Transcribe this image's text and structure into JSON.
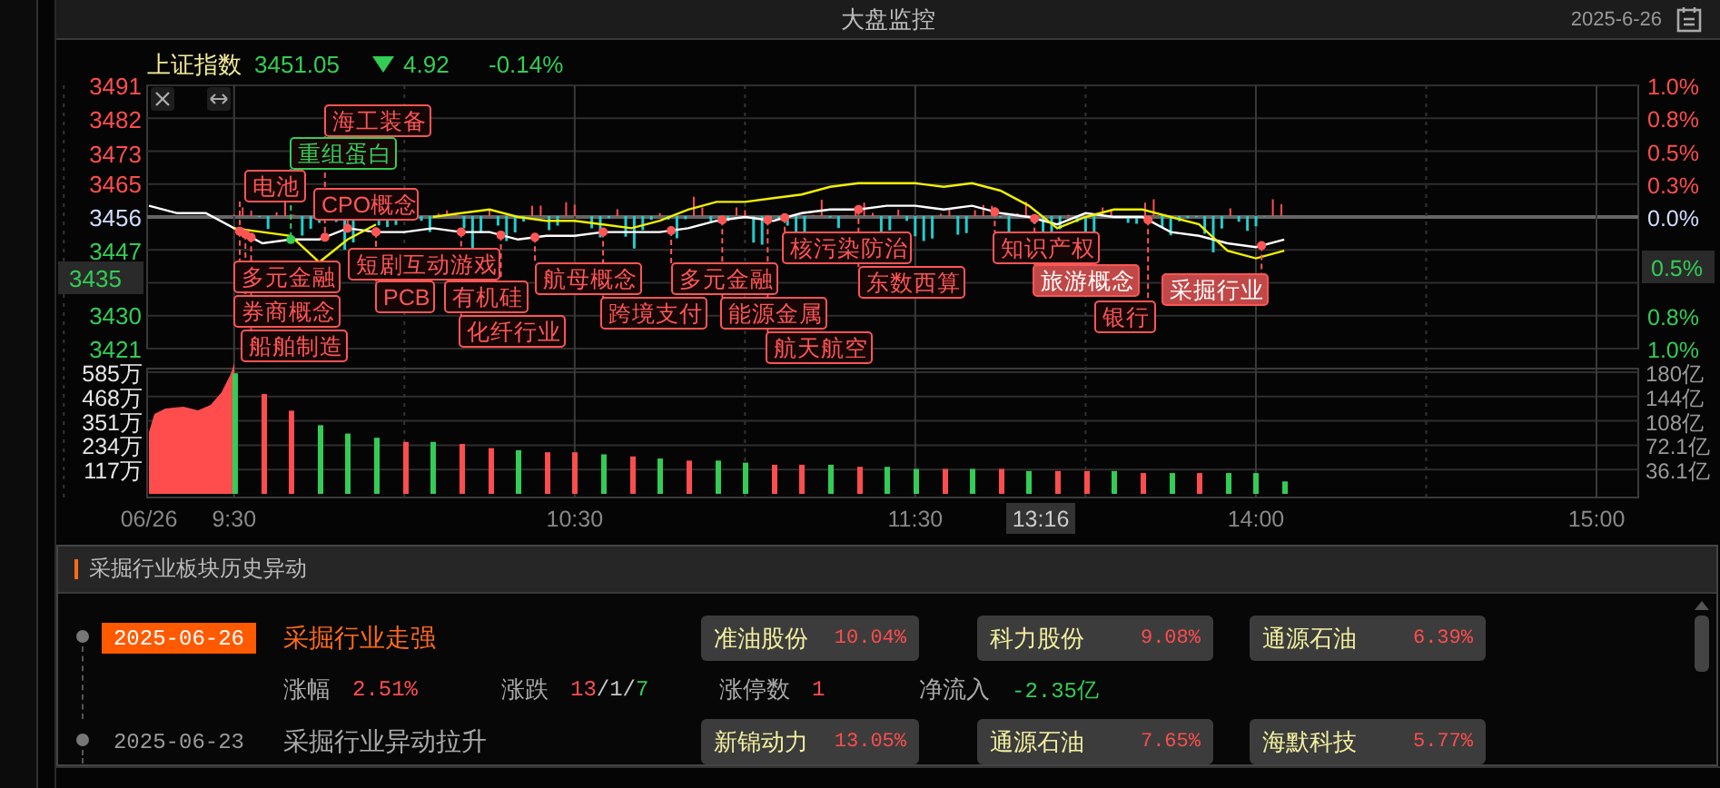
{
  "window": {
    "title": "大盘监控",
    "date": "2025-6-26"
  },
  "quote": {
    "name": "上证指数",
    "price": "3451.05",
    "change": "4.92",
    "percent": "-0.14%",
    "falling": true
  },
  "price_chart": {
    "cursor": {
      "price": "3435",
      "percent": "0.5%",
      "time": "13:16"
    },
    "right_ticks": [
      {
        "label": "1.0%",
        "kind": "up"
      },
      {
        "label": "0.8%",
        "kind": "up"
      },
      {
        "label": "0.5%",
        "kind": "up"
      },
      {
        "label": "0.3%",
        "kind": "up"
      },
      {
        "label": "0.0%",
        "kind": "flat"
      },
      {
        "label": "0.8%",
        "kind": "down"
      },
      {
        "label": "1.0%",
        "kind": "down"
      }
    ],
    "events": [
      {
        "text": "海工装备",
        "color": "#ff5555",
        "selected": false
      },
      {
        "text": "重组蛋白",
        "color": "#33cc55",
        "selected": false
      },
      {
        "text": "电池",
        "color": "#ff5555",
        "selected": false
      },
      {
        "text": "CPO概念",
        "color": "#ff5555",
        "selected": false
      },
      {
        "text": "核污染防治",
        "color": "#ff5555",
        "selected": false
      },
      {
        "text": "知识产权",
        "color": "#ff5555",
        "selected": false
      },
      {
        "text": "短剧互动游戏",
        "color": "#ff5555",
        "selected": false
      },
      {
        "text": "多元金融",
        "color": "#ff5555",
        "selected": false
      },
      {
        "text": "航母概念",
        "color": "#ff5555",
        "selected": false
      },
      {
        "text": "多元金融",
        "color": "#ff5555",
        "selected": false
      },
      {
        "text": "东数西算",
        "color": "#ff5555",
        "selected": false
      },
      {
        "text": "旅游概念",
        "color": "#ff5555",
        "selected": true
      },
      {
        "text": "PCB",
        "color": "#ff5555",
        "selected": false
      },
      {
        "text": "有机硅",
        "color": "#ff5555",
        "selected": false
      },
      {
        "text": "采掘行业",
        "color": "#ff5555",
        "selected": true
      },
      {
        "text": "券商概念",
        "color": "#ff5555",
        "selected": false
      },
      {
        "text": "跨境支付",
        "color": "#ff5555",
        "selected": false
      },
      {
        "text": "能源金属",
        "color": "#ff5555",
        "selected": false
      },
      {
        "text": "银行",
        "color": "#ff5555",
        "selected": false
      },
      {
        "text": "化纤行业",
        "color": "#ff5555",
        "selected": false
      },
      {
        "text": "船舶制造",
        "color": "#ff5555",
        "selected": false
      },
      {
        "text": "航天航空",
        "color": "#ff5555",
        "selected": false
      }
    ],
    "chart_data": {
      "type": "line",
      "ylim": [
        3421,
        3491
      ],
      "categories": [
        null,
        null,
        null,
        null,
        null,
        null,
        null,
        null,
        null,
        null,
        null,
        null,
        null,
        null,
        null,
        null,
        null,
        null,
        null,
        null,
        null,
        null,
        null,
        null,
        null,
        null,
        null,
        null,
        null,
        null,
        null,
        null,
        null,
        null,
        null,
        null,
        null,
        null,
        null,
        null,
        null,
        null,
        null,
        null,
        null,
        null,
        null,
        null,
        null,
        null,
        null,
        null
      ],
      "yticks": [
        3491,
        3482,
        3473,
        3465,
        3456,
        3447,
        3430,
        3421
      ],
      "series": [
        {
          "color": "#ffffff",
          "values": [
            3459,
            3457,
            3457,
            3453,
            3449,
            3450,
            3450,
            3453,
            3452,
            3452,
            3453,
            3452,
            3452,
            3450,
            3451,
            3451,
            3452,
            3452,
            3452,
            3453,
            3455,
            3456,
            3455,
            3457,
            3458,
            3458,
            3459,
            3459,
            3458,
            3459,
            3457,
            3456,
            3454,
            3457,
            3456,
            3456,
            3452,
            3451,
            3449,
            3448,
            3450,
            null,
            null,
            null,
            null,
            null,
            null,
            null,
            null,
            null,
            null,
            null
          ]
        },
        {
          "color": "#f0f000",
          "values": [
            null,
            null,
            null,
            3453,
            3452,
            3451,
            3444,
            3450,
            3454,
            null,
            3456,
            3457,
            3458,
            3456,
            3455,
            3455,
            3454,
            3453,
            3455,
            3458,
            3460,
            3460,
            3461,
            3462,
            3464,
            3465,
            3465,
            3465,
            3464,
            3465,
            3463,
            3459,
            3453,
            3456,
            3458,
            3458,
            3456,
            3454,
            3447,
            3445,
            3447,
            null,
            null,
            null,
            null,
            null,
            null,
            null,
            null,
            null,
            null,
            null
          ]
        }
      ]
    }
  },
  "volume_chart": {
    "right_ticks": [
      "180亿",
      "144亿",
      "108亿",
      "72.1亿",
      "36.1亿"
    ],
    "rising": [
      false,
      true,
      true,
      false,
      false,
      false,
      true,
      false,
      true,
      true,
      false,
      true,
      true,
      false,
      true,
      false,
      true,
      false,
      false,
      true,
      true,
      false,
      true,
      false,
      false,
      true,
      false,
      true,
      false,
      true,
      true,
      false,
      true,
      false,
      true,
      false,
      false,
      false
    ],
    "chart_data": {
      "type": "bar",
      "ylim": [
        0,
        585
      ],
      "categories": [
        "06/26",
        null,
        null,
        "9:30",
        null,
        null,
        null,
        null,
        null,
        null,
        null,
        null,
        null,
        null,
        null,
        "10:30",
        null,
        null,
        null,
        null,
        null,
        null,
        null,
        null,
        null,
        null,
        null,
        "11:30",
        null,
        null,
        null,
        null,
        null,
        null,
        null,
        null,
        null,
        null,
        null,
        "14:00",
        null,
        null,
        null,
        null,
        null,
        null,
        null,
        null,
        null,
        null,
        null,
        "15:00"
      ],
      "yticks": [
        {
          "value": 585,
          "label": "585万"
        },
        {
          "value": 468,
          "label": "468万"
        },
        {
          "value": 351,
          "label": "351万"
        },
        {
          "value": 234,
          "label": "234万"
        },
        {
          "value": 117,
          "label": "117万"
        }
      ],
      "series": [
        {
          "values": [
            null,
            null,
            null,
            580,
            480,
            400,
            330,
            290,
            270,
            250,
            250,
            240,
            220,
            210,
            200,
            200,
            190,
            180,
            170,
            160,
            160,
            150,
            140,
            140,
            140,
            130,
            130,
            120,
            120,
            120,
            120,
            110,
            110,
            110,
            110,
            100,
            100,
            100,
            100,
            100,
            60,
            null,
            null,
            null,
            null,
            null,
            null,
            null,
            null,
            null,
            null,
            null
          ]
        }
      ]
    }
  },
  "history": {
    "title": "采掘行业板块历史异动",
    "events": [
      {
        "date": "2025-06-26",
        "selected": true,
        "title": "采掘行业走强",
        "stocks": [
          {
            "name": "准油股份",
            "percent": "10.04%"
          },
          {
            "name": "科力股份",
            "percent": "9.08%"
          },
          {
            "name": "通源石油",
            "percent": "6.39%"
          }
        ],
        "stats": [
          {
            "label": "涨幅",
            "parts": [
              {
                "text": "2.51%",
                "kind": "up"
              }
            ]
          },
          {
            "label": "涨跌",
            "parts": [
              {
                "text": "13",
                "kind": "up"
              },
              {
                "text": "/1/",
                "kind": "flat"
              },
              {
                "text": "7",
                "kind": "down"
              }
            ]
          },
          {
            "label": "涨停数",
            "parts": [
              {
                "text": "1",
                "kind": "up"
              }
            ]
          },
          {
            "label": "净流入",
            "parts": [
              {
                "text": "-2.35亿",
                "kind": "down"
              }
            ]
          }
        ]
      },
      {
        "date": "2025-06-23",
        "selected": false,
        "title": "采掘行业异动拉升",
        "stocks": [
          {
            "name": "新锦动力",
            "percent": "13.05%"
          },
          {
            "name": "通源石油",
            "percent": "7.65%"
          },
          {
            "name": "海默科技",
            "percent": "5.77%"
          }
        ]
      }
    ]
  }
}
